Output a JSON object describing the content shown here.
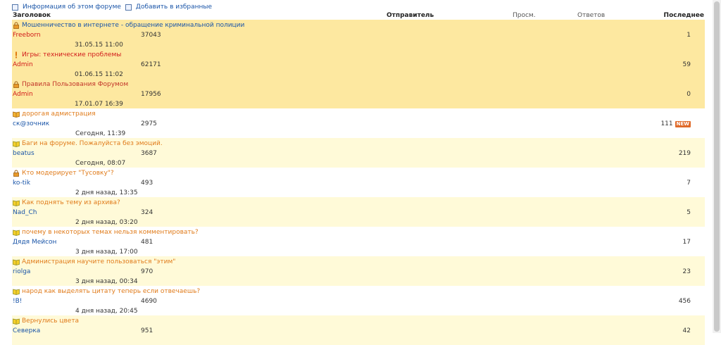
{
  "toplinks": {
    "info_label": "Информация об этом форуме",
    "fav_label": "Добавить в избранные"
  },
  "header": {
    "title_col": "Заголовок",
    "sender_col": "Отправитель",
    "views_col": "Просм.",
    "replies_col": "Ответов",
    "last_col": "Последнее"
  },
  "topics": [
    {
      "title": "Мошенничество в интернете - обращение криминальной полиции",
      "author": "Freeborn",
      "views": "37043",
      "date": "31.05.15 11:00",
      "last": "1",
      "icon": "lock-icon",
      "kind": "pinned"
    },
    {
      "title": "Игры: технические проблемы",
      "author": "Admin",
      "views": "62171",
      "date": "01.06.15 11:02",
      "last": "59",
      "icon": "exclamation-icon",
      "kind": "pinned hot"
    },
    {
      "title": "Правила Пользования Форумом",
      "author": "Admin",
      "views": "17956",
      "date": "17.01.07 16:39",
      "last": "0",
      "icon": "lock-icon",
      "kind": "pinned rules"
    },
    {
      "title": "дорогая адмистрация",
      "author": "ск@зочник",
      "views": "2975",
      "date": "Сегодня, 11:39",
      "last": "111",
      "icon": "open-book-icon",
      "kind": "plain",
      "badge": "NEW"
    },
    {
      "title": "Баги на форуме. Пожалуйста без эмоций.",
      "author": "beatus",
      "views": "3687",
      "date": "Сегодня, 08:07",
      "last": "219",
      "icon": "book-icon",
      "kind": "alt"
    },
    {
      "title": "Кто модерирует \"Тусовку\"?",
      "author": "ko-tik",
      "views": "493",
      "date": "2 дня назад, 13:35",
      "last": "7",
      "icon": "lock-icon",
      "kind": "plain"
    },
    {
      "title": "Как поднять тему из архива?",
      "author": "Nad_Ch",
      "views": "324",
      "date": "2 дня назад, 03:20",
      "last": "5",
      "icon": "book-icon",
      "kind": "alt"
    },
    {
      "title": "почему в некоторых темах нельзя комментировать?",
      "author": "Дядя Мейсон",
      "views": "481",
      "date": "3 дня назад, 17:00",
      "last": "17",
      "icon": "book-icon",
      "kind": "plain"
    },
    {
      "title": "Администрация научите пользоваться \"этим\"",
      "author": "riolga",
      "views": "970",
      "date": "3 дня назад, 00:34",
      "last": "23",
      "icon": "book-icon",
      "kind": "alt"
    },
    {
      "title": "народ как выделять цитату теперь если отвечаешь?",
      "author": "!B!",
      "views": "4690",
      "date": "4 дня назад, 20:45",
      "last": "456",
      "icon": "book-icon",
      "kind": "plain"
    },
    {
      "title": "Вернулись цвета",
      "author": "Северка",
      "views": "951",
      "date": "",
      "last": "42",
      "icon": "book-icon",
      "kind": "alt"
    }
  ]
}
